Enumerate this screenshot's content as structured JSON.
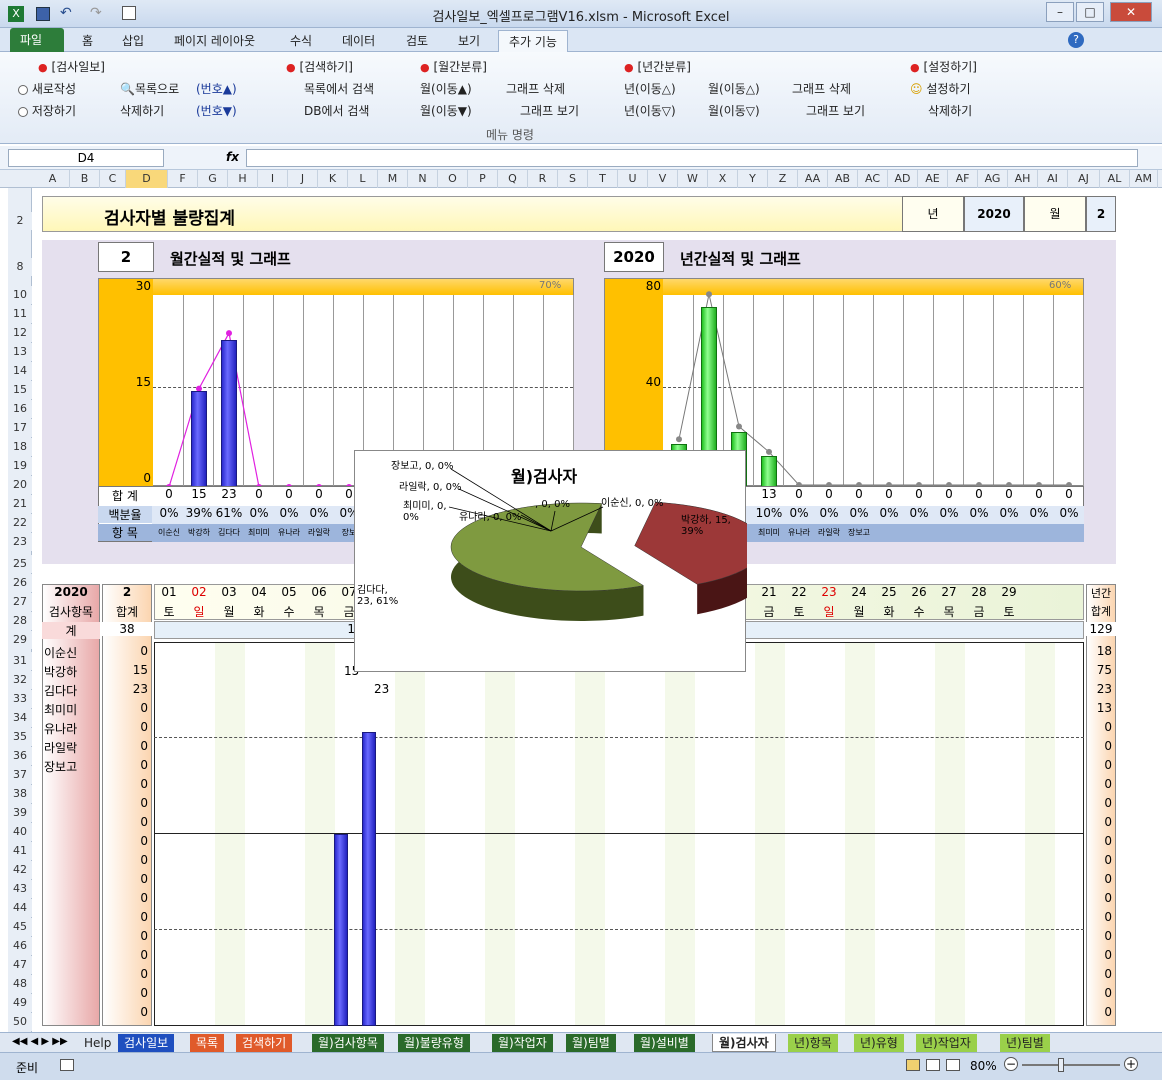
{
  "window": {
    "title": "검사일보_엑셀프로그램V16.xlsm  -  Microsoft Excel"
  },
  "ribbon_tabs": [
    "파일",
    "홈",
    "삽입",
    "페이지 레이아웃",
    "수식",
    "데이터",
    "검토",
    "보기",
    "추가 기능"
  ],
  "ribbon": {
    "groups": [
      "[검사일보]",
      "[검색하기]",
      "[월간분류]",
      "[년간분류]",
      "[설정하기]"
    ],
    "r1": [
      "새로작성",
      "목록으로",
      "(번호▲)",
      "목록에서 검색",
      "월(이동▲)",
      "그래프 삭제",
      "년(이동△)",
      "월(이동△)",
      "그래프 삭제",
      "설정하기"
    ],
    "r2": [
      "저장하기",
      "삭제하기",
      "(번호▼)",
      "DB에서 검색",
      "월(이동▼)",
      "그래프 보기",
      "년(이동▽)",
      "월(이동▽)",
      "그래프 보기",
      "삭제하기"
    ],
    "caption": "메뉴 명령"
  },
  "formula": {
    "namebox": "D4",
    "fx": "fx"
  },
  "columns": [
    "A",
    "B",
    "C",
    "D",
    "F",
    "G",
    "H",
    "I",
    "J",
    "K",
    "L",
    "M",
    "N",
    "O",
    "P",
    "Q",
    "R",
    "S",
    "T",
    "U",
    "V",
    "W",
    "X",
    "Y",
    "Z",
    "AA",
    "AB",
    "AC",
    "AD",
    "AE",
    "AF",
    "AG",
    "AH",
    "AI",
    "AJ",
    "AL",
    "AM"
  ],
  "rows": [
    "2",
    "8",
    "10",
    "11",
    "12",
    "13",
    "14",
    "15",
    "16",
    "17",
    "18",
    "19",
    "20",
    "21",
    "22",
    "23",
    "25",
    "26",
    "27",
    "28",
    "29",
    "31",
    "32",
    "33",
    "34",
    "35",
    "36",
    "37",
    "38",
    "39",
    "40",
    "41",
    "42",
    "43",
    "44",
    "45",
    "46",
    "47",
    "48",
    "49",
    "50"
  ],
  "header": {
    "title": "검사자별 불량집계",
    "year_label": "년",
    "year": "2020",
    "month_label": "월",
    "month": "2"
  },
  "monthly": {
    "num": "2",
    "title": "월간실적 및 그래프",
    "ymax": "30",
    "ymid": "15",
    "ymin": "0",
    "pct": "70%",
    "totals": [
      "0",
      "15",
      "23",
      "0",
      "0",
      "0",
      "0"
    ],
    "rates": [
      "0%",
      "39%",
      "61%",
      "0%",
      "0%",
      "0%",
      "0%"
    ],
    "items": [
      "이순신",
      "박강하",
      "김다다",
      "최미미",
      "유나라",
      "라일락",
      "장보"
    ],
    "total_label": "합 계",
    "rate_label": "백분율",
    "item_label": "항 목"
  },
  "yearly": {
    "num": "2020",
    "title": "년간실적 및 그래프",
    "ymax": "80",
    "ymid": "40",
    "pct": "60%",
    "totals": [
      "13",
      "0",
      "0",
      "0",
      "0",
      "0",
      "0",
      "0",
      "0",
      "0",
      "0"
    ],
    "rates": [
      "10%",
      "0%",
      "0%",
      "0%",
      "0%",
      "0%",
      "0%",
      "0%",
      "0%",
      "0%",
      "0%"
    ],
    "items": [
      "최미미",
      "유나라",
      "라일락",
      "장보고"
    ]
  },
  "chart_data": {
    "type": "pie",
    "title": "월)검사자",
    "categories": [
      "이순신",
      "박강하",
      "김다다",
      "최미미",
      "유나라",
      "라일락",
      "장보고",
      ""
    ],
    "values": [
      0,
      15,
      23,
      0,
      0,
      0,
      0,
      0
    ],
    "labels": [
      "이순신, 0, 0%",
      "박강하, 15, 39%",
      "김다다, 23, 61%",
      "최미미, 0, 0%",
      "유나라, 0, 0%",
      "라일락, 0, 0%",
      "장보고, 0, 0%",
      ", 0, 0%"
    ]
  },
  "daily": {
    "year": "2020",
    "month": "2",
    "item_label": "검사항목",
    "sum_label": "합계",
    "total_row_label": "계",
    "total": "38",
    "mid_val": "15",
    "days": [
      "01",
      "02",
      "03",
      "04",
      "05",
      "06",
      "07"
    ],
    "weekdays": [
      "토",
      "일",
      "월",
      "화",
      "수",
      "목",
      "금"
    ],
    "days2": [
      "21",
      "22",
      "23",
      "24",
      "25",
      "26",
      "27",
      "28",
      "29"
    ],
    "weekdays2": [
      "금",
      "토",
      "일",
      "월",
      "화",
      "수",
      "목",
      "금",
      "토"
    ],
    "year_total_label": "년간",
    "year_sum_label": "합계",
    "year_total": "129",
    "names": [
      "이순신",
      "박강하",
      "김다다",
      "최미미",
      "유나라",
      "라일락",
      "장보고"
    ],
    "sums": [
      "0",
      "15",
      "23",
      "0",
      "0",
      "0",
      "0",
      "0",
      "0",
      "0",
      "0",
      "0",
      "0",
      "0",
      "0",
      "0",
      "0",
      "0",
      "0",
      "0"
    ],
    "year_sums": [
      "18",
      "75",
      "23",
      "13",
      "0",
      "0",
      "0",
      "0",
      "0",
      "0",
      "0",
      "0",
      "0",
      "0",
      "0",
      "0",
      "0",
      "0",
      "0",
      "0"
    ],
    "inline_vals": [
      "15",
      "23"
    ]
  },
  "sheet_tabs": [
    "Help",
    "검사일보",
    "목록",
    "검색하기",
    "월)검사항목",
    "월)불량유형",
    "월)작업자",
    "월)팀별",
    "월)설비별",
    "월)검사자",
    "년)항목",
    "년)유형",
    "년)작업자",
    "년)팀별"
  ],
  "status": {
    "ready": "준비",
    "zoom": "80%"
  }
}
